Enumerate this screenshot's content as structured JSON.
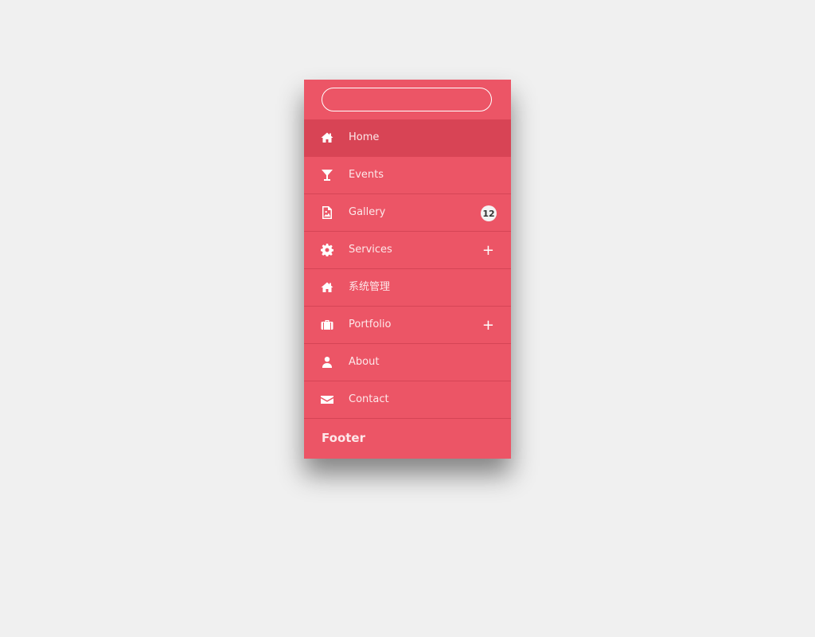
{
  "search": {
    "placeholder": "",
    "value": ""
  },
  "menu": {
    "items": [
      {
        "label": "Home",
        "icon": "home-icon",
        "active": true
      },
      {
        "label": "Events",
        "icon": "cocktail-glass-icon"
      },
      {
        "label": "Gallery",
        "icon": "image-file-icon",
        "badge": "12"
      },
      {
        "label": "Services",
        "icon": "gear-icon",
        "expand": "+"
      },
      {
        "label": "系统管理",
        "icon": "home-icon"
      },
      {
        "label": "Portfolio",
        "icon": "briefcase-icon",
        "expand": "+"
      },
      {
        "label": "About",
        "icon": "user-icon"
      },
      {
        "label": "Contact",
        "icon": "envelope-icon"
      }
    ]
  },
  "footer": {
    "label": "Footer"
  },
  "colors": {
    "background": "#f0f0f0",
    "panel": "#ec5566",
    "active_item": "#d84455",
    "divider": "#d54556",
    "badge_bg": "#f4f4f4"
  }
}
